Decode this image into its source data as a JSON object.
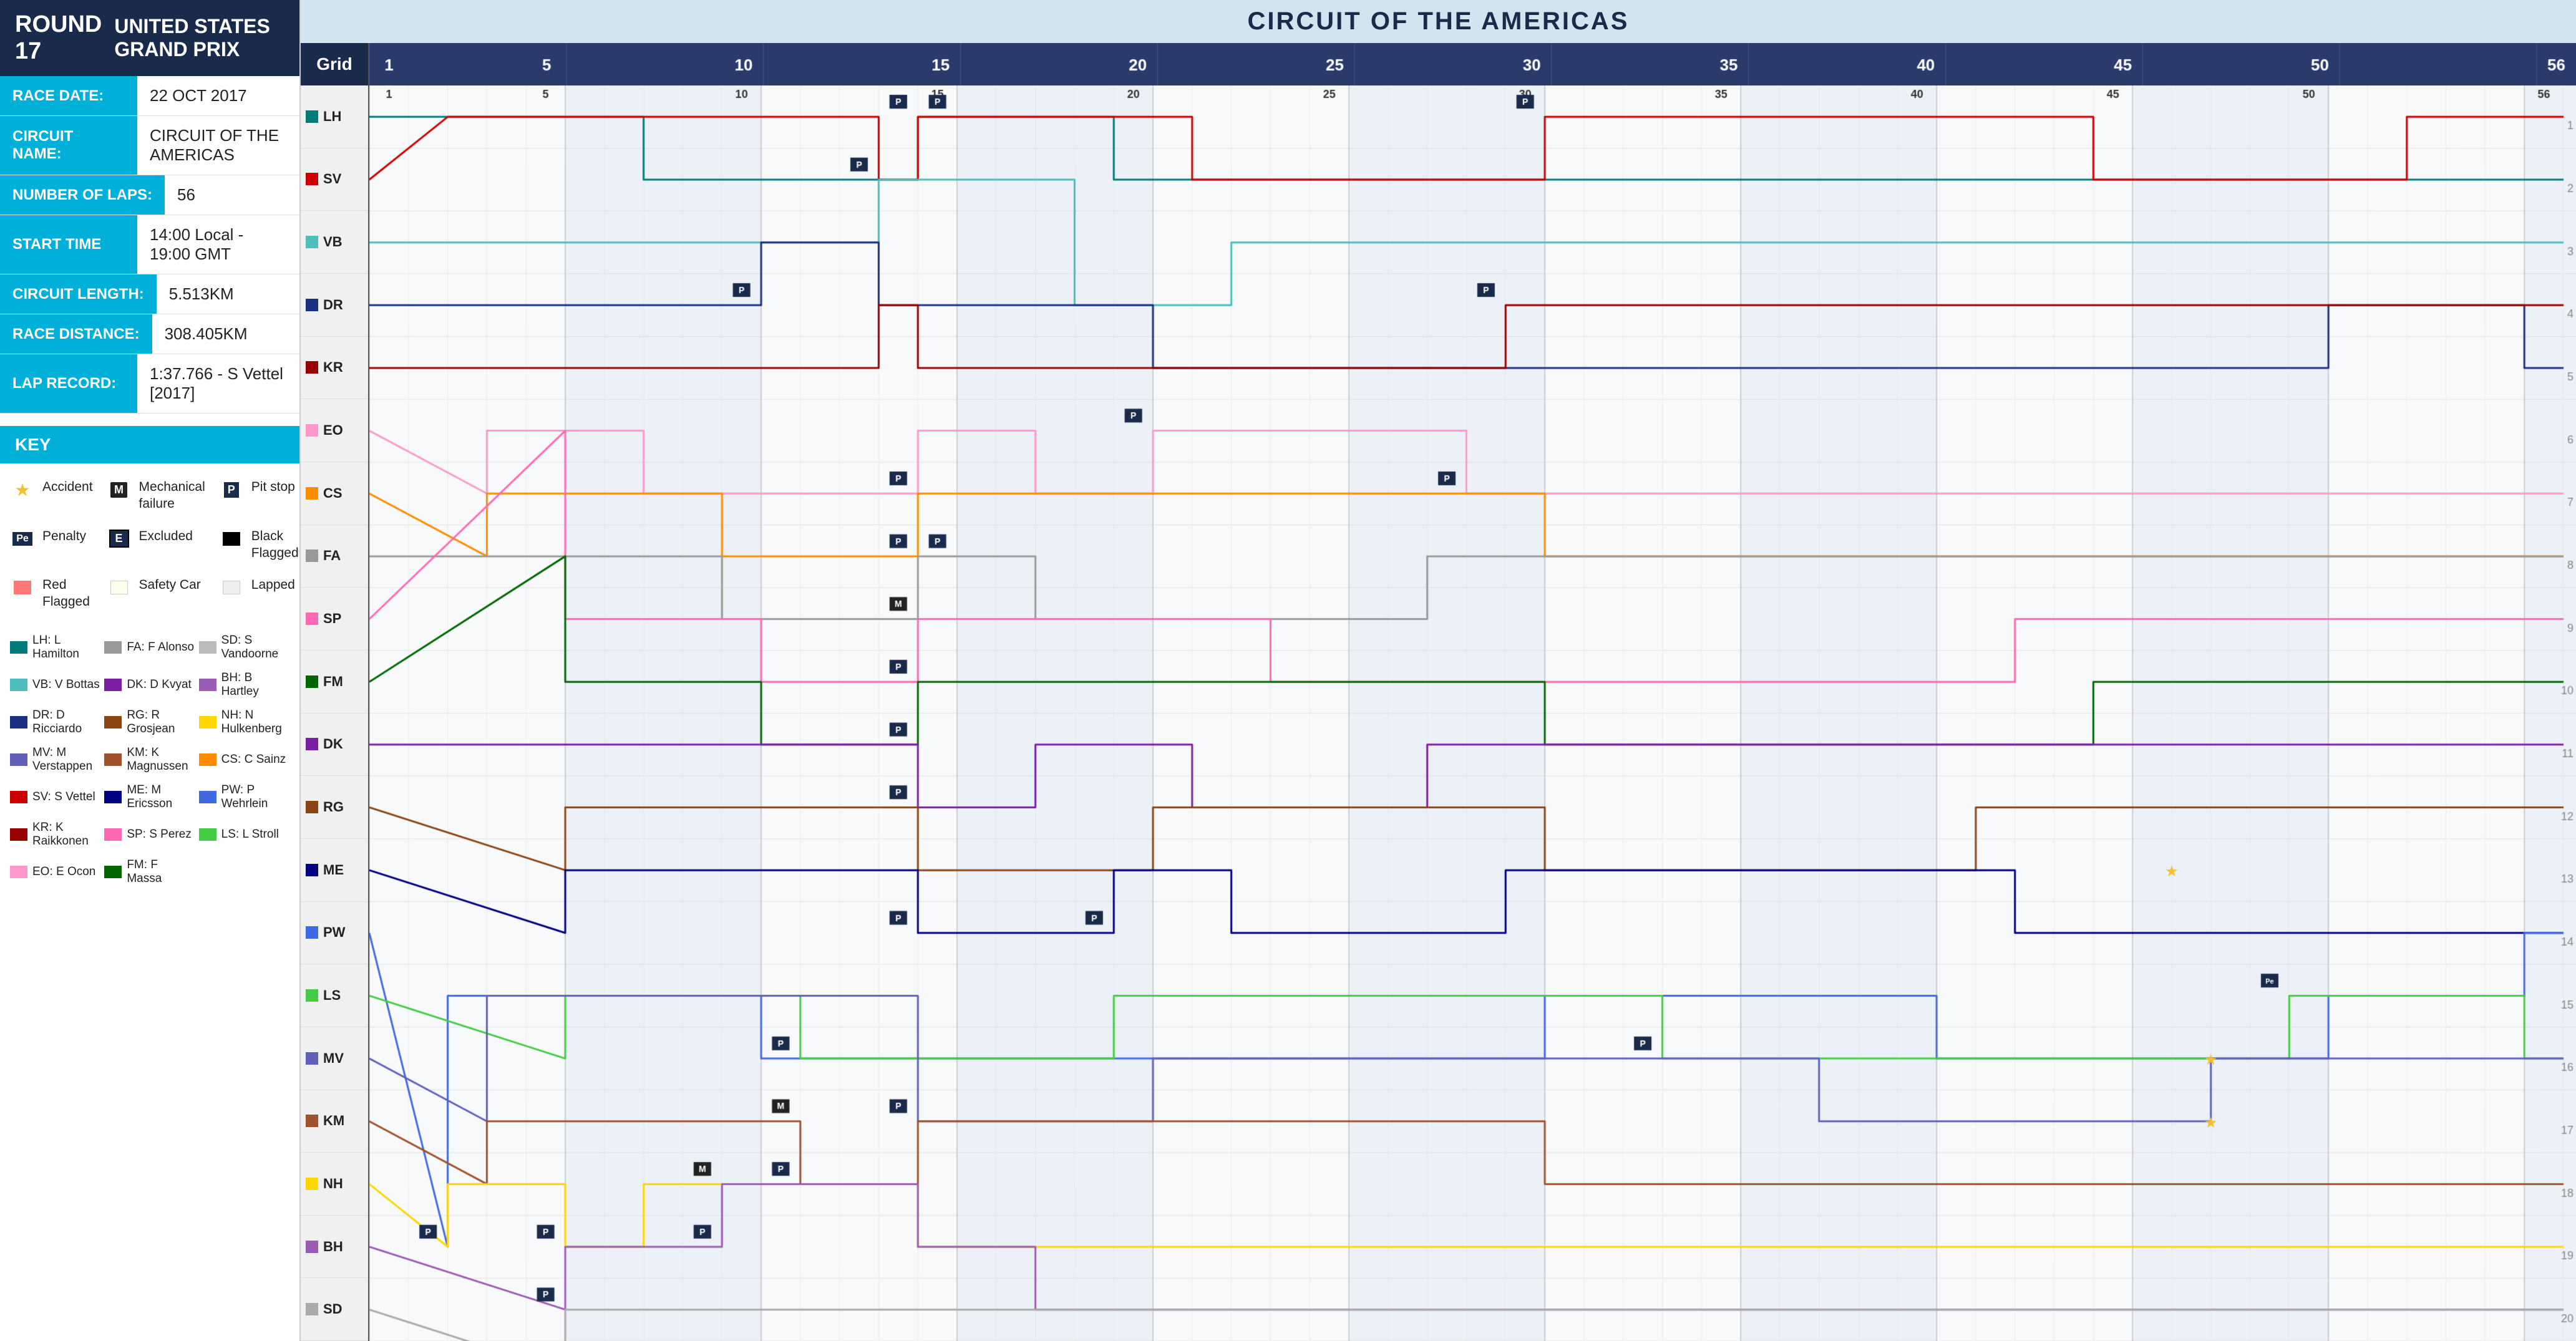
{
  "left": {
    "round_label": "ROUND 17",
    "event_name": "UNITED STATES GRAND PRIX",
    "race_date_label": "RACE DATE:",
    "race_date_value": "22 OCT 2017",
    "circuit_label": "CIRCUIT NAME:",
    "circuit_value": "CIRCUIT OF THE AMERICAS",
    "laps_label": "NUMBER OF LAPS:",
    "laps_value": "56",
    "start_label": "START TIME",
    "start_value": "14:00 Local - 19:00 GMT",
    "length_label": "CIRCUIT LENGTH:",
    "length_value": "5.513KM",
    "distance_label": "RACE DISTANCE:",
    "distance_value": "308.405KM",
    "lap_record_label": "LAP RECORD:",
    "lap_record_value": "1:37.766 - S Vettel [2017]",
    "key_label": "KEY",
    "symbols": [
      {
        "sym": "star",
        "label": "Accident"
      },
      {
        "sym": "M",
        "label": "Mechanical failure"
      },
      {
        "sym": "P",
        "label": "Pit stop"
      },
      {
        "sym": "Pe",
        "label": "Penalty"
      },
      {
        "sym": "E",
        "label": "Excluded"
      },
      {
        "sym": "bf",
        "label": "Black Flagged"
      },
      {
        "sym": "rf",
        "label": "Red Flagged"
      },
      {
        "sym": "sc",
        "label": "Safety Car"
      },
      {
        "sym": "lap",
        "label": "Lapped"
      }
    ],
    "drivers": [
      {
        "code": "LH",
        "name": "L Hamilton",
        "color": "#008080"
      },
      {
        "code": "VB",
        "name": "V Bottas",
        "color": "#20b2aa"
      },
      {
        "code": "DR",
        "name": "D Ricciardo",
        "color": "#1a3a8a"
      },
      {
        "code": "MV",
        "name": "M Verstappen",
        "color": "#7070cc"
      },
      {
        "code": "SV",
        "name": "S Vettel",
        "color": "#cc0000"
      },
      {
        "code": "KR",
        "name": "K Raikkonen",
        "color": "#aa0000"
      },
      {
        "code": "SP",
        "name": "S Perez",
        "color": "#ff69b4"
      },
      {
        "code": "EO",
        "name": "E Ocon",
        "color": "#ff99cc"
      },
      {
        "code": "FM",
        "name": "F Massa",
        "color": "#006600"
      },
      {
        "code": "LS",
        "name": "L Stroll",
        "color": "#44cc44"
      },
      {
        "code": "FA",
        "name": "F Alonso",
        "color": "#888888"
      },
      {
        "code": "SD",
        "name": "S Vandoorne",
        "color": "#aaaaaa"
      },
      {
        "code": "DK",
        "name": "D Kvyat",
        "color": "#8b008b"
      },
      {
        "code": "BH",
        "name": "B Hartley",
        "color": "#9955bb"
      },
      {
        "code": "RG",
        "name": "R Grosjean",
        "color": "#8b4513"
      },
      {
        "code": "KM",
        "name": "K Magnussen",
        "color": "#a0522d"
      },
      {
        "code": "NH",
        "name": "N Hulkenberg",
        "color": "#ffd700"
      },
      {
        "code": "CS",
        "name": "C Sainz",
        "color": "#ff8c00"
      },
      {
        "code": "ME",
        "name": "M Ericsson",
        "color": "#000080"
      },
      {
        "code": "PW",
        "name": "P Wehrlein",
        "color": "#4169e1"
      }
    ]
  },
  "chart": {
    "title": "CIRCUIT OF THE AMERICAS",
    "grid_label": "Grid",
    "total_laps": 56,
    "lap_markers": [
      1,
      5,
      10,
      15,
      20,
      25,
      30,
      35,
      40,
      45,
      50,
      56
    ],
    "positions": [
      {
        "num": 1,
        "driver": "LH"
      },
      {
        "num": 2,
        "driver": "SV"
      },
      {
        "num": 3,
        "driver": "VB"
      },
      {
        "num": 4,
        "driver": "DR"
      },
      {
        "num": 5,
        "driver": "KR"
      },
      {
        "num": 6,
        "driver": "EO"
      },
      {
        "num": 7,
        "driver": "CS"
      },
      {
        "num": 8,
        "driver": "FA"
      },
      {
        "num": 9,
        "driver": "SP"
      },
      {
        "num": 10,
        "driver": "FM"
      },
      {
        "num": 11,
        "driver": "DK"
      },
      {
        "num": 12,
        "driver": "RG"
      },
      {
        "num": 13,
        "driver": "ME"
      },
      {
        "num": 14,
        "driver": "PW"
      },
      {
        "num": 15,
        "driver": "LS"
      },
      {
        "num": 16,
        "driver": "MV"
      },
      {
        "num": 17,
        "driver": "KM"
      },
      {
        "num": 18,
        "driver": "NH"
      },
      {
        "num": 19,
        "driver": "BH"
      },
      {
        "num": 20,
        "driver": "SD"
      }
    ]
  }
}
